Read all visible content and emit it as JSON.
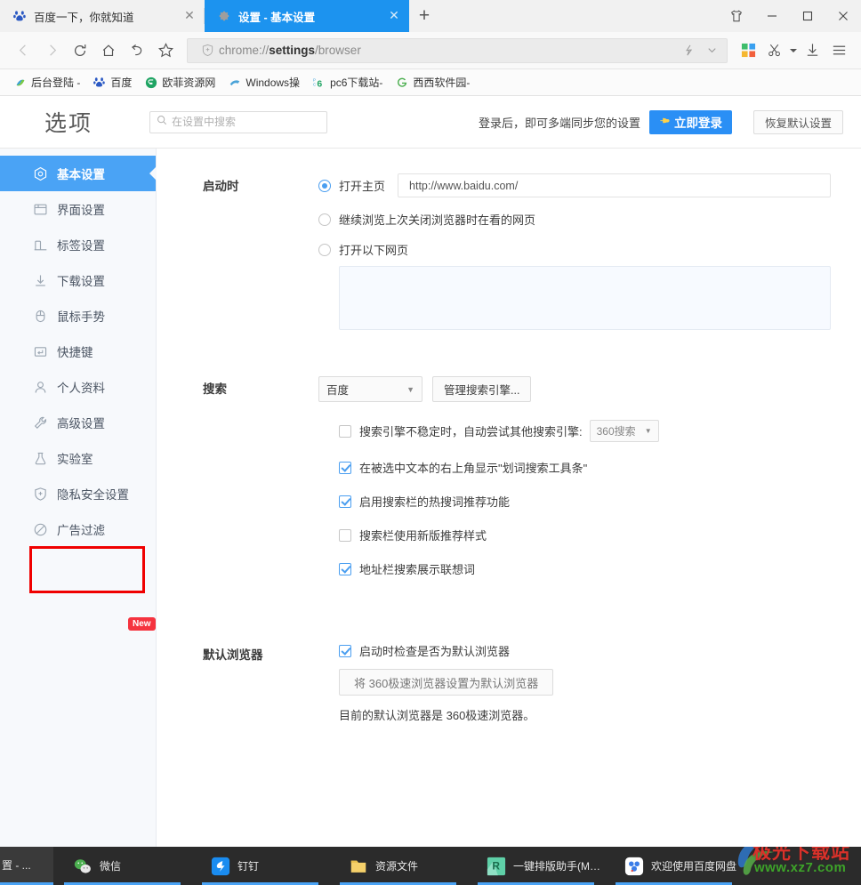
{
  "window": {
    "controls": [
      {
        "name": "skin-icon",
        "glyph": "skin"
      },
      {
        "name": "minimize",
        "glyph": "minimize"
      },
      {
        "name": "maximize",
        "glyph": "maximize"
      },
      {
        "name": "close",
        "glyph": "close"
      }
    ]
  },
  "tabs": [
    {
      "title": "百度一下，你就知道",
      "favicon": "baidu-icon",
      "active": false,
      "close": "✕"
    },
    {
      "title": "设置 - 基本设置",
      "favicon": "gear-icon",
      "active": true,
      "close": "✕"
    }
  ],
  "new_tab_label": "+",
  "address_bar": {
    "security_icon": "shield-plus-icon",
    "url_prefix": "chrome://",
    "url_bold": "settings",
    "url_suffix": "/browser",
    "full_url": "chrome://settings/browser",
    "right_icons": [
      "lightning-icon",
      "chevron-down-icon"
    ]
  },
  "toolbar_icons": [
    {
      "name": "back-icon",
      "glyph": "‹",
      "disabled": true
    },
    {
      "name": "forward-icon",
      "glyph": "›",
      "disabled": true
    },
    {
      "name": "reload-icon",
      "glyph": "reload",
      "disabled": false
    },
    {
      "name": "home-icon",
      "glyph": "home",
      "disabled": false
    },
    {
      "name": "undo-icon",
      "glyph": "undo",
      "disabled": false
    },
    {
      "name": "bookmark-star-icon",
      "glyph": "star",
      "disabled": false
    }
  ],
  "toolbar_right_icons": [
    {
      "name": "apps-grid-icon"
    },
    {
      "name": "screenshot-scissors-icon"
    },
    {
      "name": "download-icon"
    },
    {
      "name": "menu-hamburger-icon"
    }
  ],
  "bookmarks": [
    {
      "label": "后台登陆 -",
      "icon": "swirl-icon",
      "color": "#3aa0d8"
    },
    {
      "label": "百度",
      "icon": "baidu-icon",
      "color": "#2b59c3"
    },
    {
      "label": "欧菲资源网",
      "icon": "circle-f-icon",
      "color": "#2bb673"
    },
    {
      "label": "Windows操",
      "icon": "win-icon",
      "color": "#4aa3d8"
    },
    {
      "label": "pc6下载站-",
      "icon": "pc6-icon",
      "color": "#2bb673"
    },
    {
      "label": "西西软件园-",
      "icon": "g-icon",
      "color": "#4caf50"
    }
  ],
  "settings_header": {
    "logo": "选项",
    "search_placeholder": "在设置中搜索",
    "search_value": "",
    "search_icon": "search-icon",
    "sync_text": "登录后，即可多端同步您的设置",
    "login_button": "立即登录",
    "login_icon": "hand-point-icon",
    "reset_button": "恢复默认设置",
    "accent_color": "#2a8ff5"
  },
  "sidebar": {
    "items": [
      {
        "label": "基本设置",
        "icon": "hexagon-target-icon",
        "active": true
      },
      {
        "label": "界面设置",
        "icon": "window-icon",
        "active": false
      },
      {
        "label": "标签设置",
        "icon": "tab-icon",
        "active": false
      },
      {
        "label": "下载设置",
        "icon": "download-arrow-icon",
        "active": false
      },
      {
        "label": "鼠标手势",
        "icon": "mouse-icon",
        "active": false
      },
      {
        "label": "快捷键",
        "icon": "keyboard-key-icon",
        "active": false
      },
      {
        "label": "个人资料",
        "icon": "user-icon",
        "active": false
      },
      {
        "label": "高级设置",
        "icon": "wrench-icon",
        "active": false,
        "highlighted": true
      },
      {
        "label": "实验室",
        "icon": "flask-icon",
        "active": false
      },
      {
        "label": "隐私安全设置",
        "icon": "shield-plus-icon",
        "active": false,
        "badge": "New"
      },
      {
        "label": "广告过滤",
        "icon": "block-icon",
        "active": false
      }
    ],
    "badge_new": "New",
    "active_color": "#4aa3f5",
    "highlight_color": "#f00000"
  },
  "content": {
    "startup": {
      "label": "启动时",
      "options": [
        {
          "label": "打开主页",
          "selected": true
        },
        {
          "label": "继续浏览上次关闭浏览器时在看的网页",
          "selected": false
        },
        {
          "label": "打开以下网页",
          "selected": false
        }
      ],
      "homepage_value": "http://www.baidu.com/",
      "homepage_placeholder": ""
    },
    "search": {
      "label": "搜索",
      "engine_selected": "百度",
      "manage_button": "管理搜索引擎...",
      "checkboxes": [
        {
          "label": "搜索引擎不稳定时，自动尝试其他搜索引擎:",
          "checked": false,
          "sub_select": "360搜索"
        },
        {
          "label": "在被选中文本的右上角显示\"划词搜索工具条\"",
          "checked": true
        },
        {
          "label": "启用搜索栏的热搜词推荐功能",
          "checked": true
        },
        {
          "label": "搜索栏使用新版推荐样式",
          "checked": false
        },
        {
          "label": "地址栏搜索展示联想词",
          "checked": true
        }
      ]
    },
    "default_browser": {
      "label": "默认浏览器",
      "checkbox": {
        "label": "启动时检查是否为默认浏览器",
        "checked": true
      },
      "set_button": "将 360极速浏览器设置为默认浏览器",
      "note": "目前的默认浏览器是 360极速浏览器。"
    }
  },
  "taskbar": {
    "ghost_label": "置 - ...",
    "items": [
      {
        "label": "微信",
        "icon": "wechat-icon"
      },
      {
        "label": "钉钉",
        "icon": "dingtalk-icon"
      },
      {
        "label": "资源文件",
        "icon": "folder-icon"
      },
      {
        "label": "一键排版助手(MyE...",
        "icon": "typeset-icon"
      },
      {
        "label": "欢迎使用百度网盘",
        "icon": "baidu-netdisk-icon"
      }
    ]
  },
  "watermark": {
    "line1": "极光下载站",
    "line2": "www.xz7.com"
  }
}
